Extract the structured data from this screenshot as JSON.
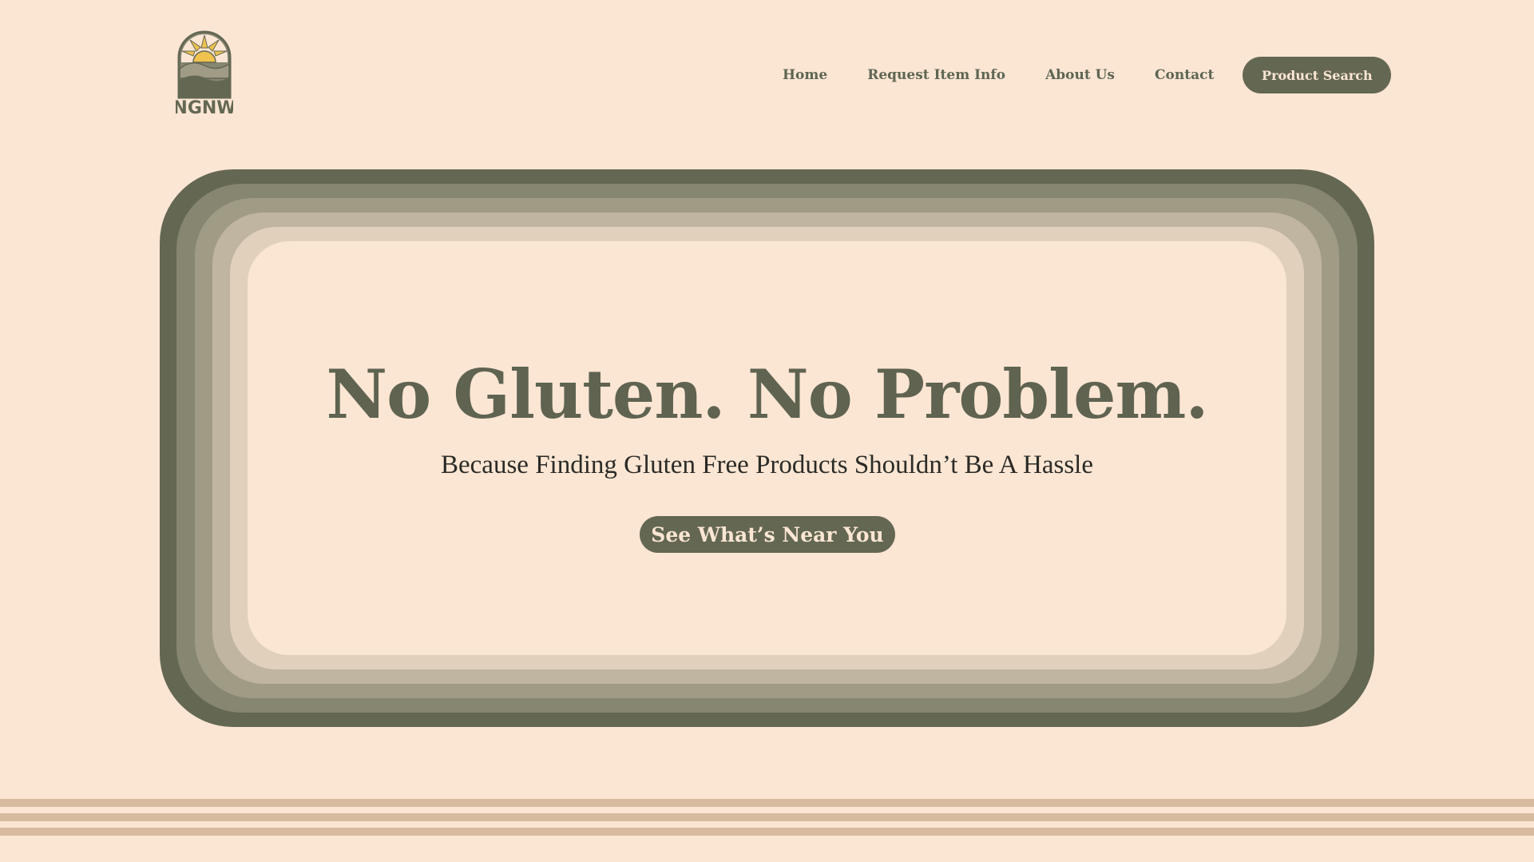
{
  "brand": {
    "logo_text": "NGNW",
    "colors": {
      "background": "#fbe6d3",
      "primary": "#646752",
      "sun": "#f0c24f"
    }
  },
  "nav": {
    "items": [
      {
        "label": "Home"
      },
      {
        "label": "Request Item Info"
      },
      {
        "label": "About Us"
      },
      {
        "label": "Contact"
      }
    ],
    "cta_label": "Product Search"
  },
  "hero": {
    "title": "No Gluten. No Problem.",
    "subtitle": "Because Finding Gluten Free Products Shouldn’t Be A Hassle",
    "cta_label": "See What’s Near You"
  }
}
